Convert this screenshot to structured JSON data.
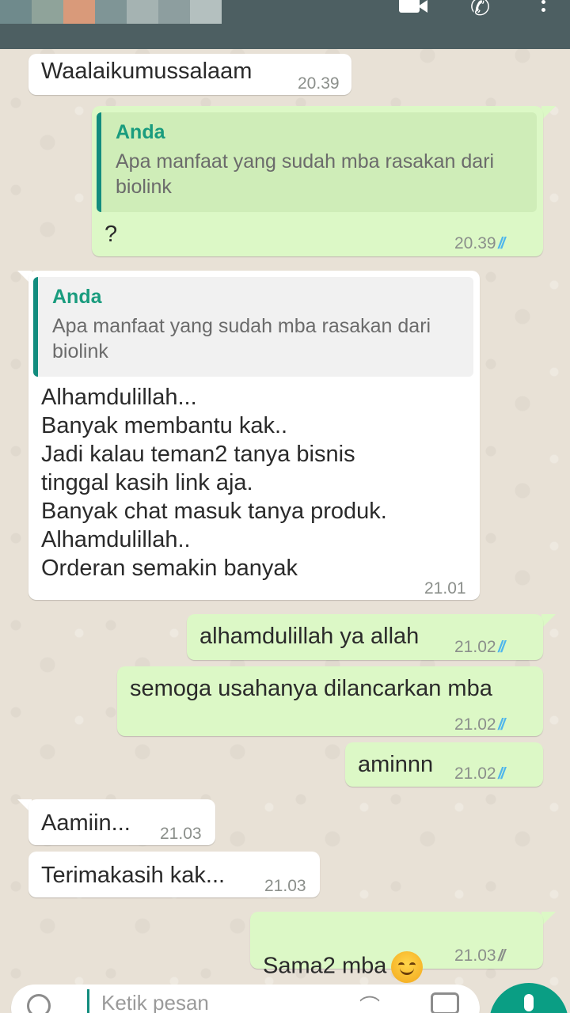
{
  "header": {
    "icons": [
      "video-call-icon",
      "voice-call-icon",
      "more-options-icon"
    ],
    "color": "#4d5f62"
  },
  "messages": [
    {
      "id": "m1",
      "dir": "in",
      "text": "Waalaikumussalaam",
      "time": "20.39"
    },
    {
      "id": "m2",
      "dir": "out",
      "quote_author": "Anda",
      "quote_text": "Apa manfaat yang sudah mba rasakan dari biolink",
      "text": "?",
      "time": "20.39",
      "status": "read"
    },
    {
      "id": "m3",
      "dir": "in",
      "quote_author": "Anda",
      "quote_text": "Apa manfaat yang sudah mba rasakan dari biolink",
      "text": "Alhamdulillah...\nBanyak membantu kak..\nJadi kalau teman2 tanya bisnis\ntinggal kasih link aja.\nBanyak chat masuk tanya produk.\nAlhamdulillah..\nOrderan semakin banyak",
      "time": "21.01"
    },
    {
      "id": "m4",
      "dir": "out",
      "text": "alhamdulillah ya allah",
      "time": "21.02",
      "status": "read"
    },
    {
      "id": "m5",
      "dir": "out",
      "text": "semoga usahanya dilancarkan mba",
      "time": "21.02",
      "status": "read"
    },
    {
      "id": "m6",
      "dir": "out",
      "text": "aminnn",
      "time": "21.02",
      "status": "read"
    },
    {
      "id": "m7",
      "dir": "in",
      "text": "Aamiin...",
      "time": "21.03"
    },
    {
      "id": "m8",
      "dir": "in",
      "text": "Terimakasih kak...",
      "time": "21.03"
    },
    {
      "id": "m9",
      "dir": "out",
      "text": "Sama2 mba",
      "emoji": "smiling-face-emoji",
      "time": "21.03",
      "status": "delivered"
    }
  ],
  "colors": {
    "incoming": "#ffffff",
    "outgoing": "#dcf8c6",
    "quote_accent": "#128c7e",
    "read_ticks": "#4fb6ec"
  },
  "input": {
    "placeholder": "Ketik pesan"
  }
}
